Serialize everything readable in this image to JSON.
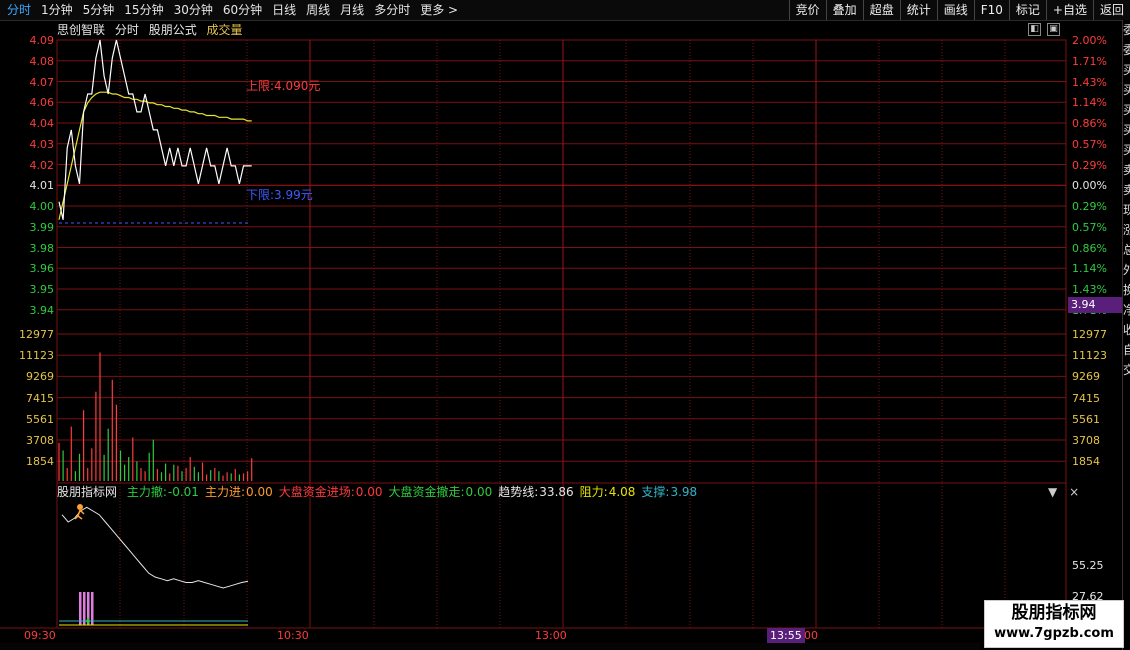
{
  "toolbar": {
    "tabs": [
      "分时",
      "1分钟",
      "5分钟",
      "15分钟",
      "30分钟",
      "60分钟",
      "日线",
      "周线",
      "月线",
      "多分时",
      "更多 >"
    ],
    "active_tab": "分时",
    "right_buttons": [
      "竞价",
      "叠加",
      "超盘",
      "统计",
      "画线",
      "F10",
      "标记",
      "+自选",
      "返回"
    ]
  },
  "title": {
    "name": "思创智联",
    "mode": "分时",
    "formula": "股朋公式",
    "volume_label": "成交量"
  },
  "price_axis": {
    "left": [
      "4.09",
      "4.08",
      "4.07",
      "4.06",
      "4.04",
      "4.03",
      "4.02",
      "4.01",
      "4.00",
      "3.99",
      "3.98",
      "3.96",
      "3.95",
      "3.94"
    ],
    "right": [
      "2.00%",
      "1.71%",
      "1.43%",
      "1.14%",
      "0.86%",
      "0.57%",
      "0.29%",
      "0.00%",
      "0.29%",
      "0.57%",
      "0.86%",
      "1.14%",
      "1.43%",
      "1.71%"
    ]
  },
  "volume_axis": [
    "12977",
    "11123",
    "9269",
    "7415",
    "5561",
    "3708",
    "1854"
  ],
  "annotations": {
    "upper_limit": "上限:4.090元",
    "lower_limit": "下限:3.99元"
  },
  "current_price_tag": "3.94",
  "indicator": {
    "name": "股朋指标网",
    "items": [
      {
        "label": "主力撤:",
        "value": "-0.01",
        "color": "#2ecc40"
      },
      {
        "label": "主力进:",
        "value": "0.00",
        "color": "#ff9a2e"
      },
      {
        "label": "大盘资金进场:",
        "value": "0.00",
        "color": "#ff3b3b"
      },
      {
        "label": "大盘资金撤走:",
        "value": "0.00",
        "color": "#2ecc40"
      },
      {
        "label": "趋势线:",
        "value": "33.86",
        "color": "#e6e6e6"
      },
      {
        "label": "阻力:",
        "value": "4.08",
        "color": "#e6e600"
      },
      {
        "label": "支撑:",
        "value": "3.98",
        "color": "#2fb5c8"
      }
    ],
    "axis": [
      "55.25",
      "27.62"
    ],
    "controls": [
      "▼",
      "×"
    ]
  },
  "time_axis": {
    "labels": [
      "09:30",
      "10:30",
      "13:00"
    ],
    "cursor": "13:55",
    "cursor_suffix": "00"
  },
  "watermark": {
    "line1": "股朋指标网",
    "line2": "www.7gpzb.com"
  },
  "sidebar_chars": [
    "委",
    "委",
    "买",
    "买",
    "买",
    "买",
    "买",
    "卖",
    "卖",
    "现",
    "涨",
    "总",
    "外",
    "换",
    "净",
    "收",
    "自",
    "交"
  ],
  "chart_data": {
    "type": "line",
    "series": [
      {
        "values": [
          4.0,
          3.99,
          4.03,
          4.04,
          4.02,
          4.01,
          4.05,
          4.06,
          4.06,
          4.08,
          4.09,
          4.07,
          4.06,
          4.08,
          4.09,
          4.08,
          4.07,
          4.06,
          4.06,
          4.05,
          4.05,
          4.06,
          4.05,
          4.04,
          4.04,
          4.03,
          4.02,
          4.03,
          4.02,
          4.03,
          4.02,
          4.02,
          4.03,
          4.02,
          4.01,
          4.02,
          4.03,
          4.02,
          4.02,
          4.01,
          4.02,
          4.03,
          4.02,
          4.02,
          4.01,
          4.02,
          4.02,
          4.02
        ]
      },
      {
        "values": [
          3.99,
          4.0,
          4.01,
          4.02,
          4.03,
          4.04,
          4.05,
          4.055,
          4.058,
          4.06,
          4.061,
          4.061,
          4.061,
          4.06,
          4.06,
          4.059,
          4.058,
          4.058,
          4.057,
          4.057,
          4.056,
          4.056,
          4.055,
          4.055,
          4.054,
          4.054,
          4.053,
          4.053,
          4.052,
          4.052,
          4.051,
          4.051,
          4.05,
          4.05,
          4.049,
          4.049,
          4.048,
          4.048,
          4.048,
          4.047,
          4.047,
          4.047,
          4.046,
          4.046,
          4.046,
          4.046,
          4.045,
          4.045
        ]
      }
    ],
    "volume": [
      3500,
      2800,
      1200,
      5000,
      900,
      2500,
      6500,
      1200,
      3000,
      8200,
      11800,
      2400,
      4800,
      9300,
      7000,
      2800,
      1500,
      2200,
      4000,
      1800,
      1200,
      900,
      2600,
      3800,
      1100,
      800,
      1600,
      700,
      1500,
      1400,
      900,
      1200,
      2200,
      1300,
      800,
      1700,
      600,
      1000,
      1200,
      900,
      500,
      800,
      700,
      1100,
      600,
      700,
      900,
      2100
    ],
    "indicator_line": [
      52,
      50,
      51,
      53,
      54,
      53,
      52,
      50,
      48,
      46,
      44,
      42,
      40,
      38,
      36,
      35,
      34.5,
      34,
      34.5,
      34,
      33.5,
      33.5,
      34,
      33.5,
      33,
      32.5,
      32,
      32.5,
      33,
      33.5,
      33.86
    ]
  }
}
